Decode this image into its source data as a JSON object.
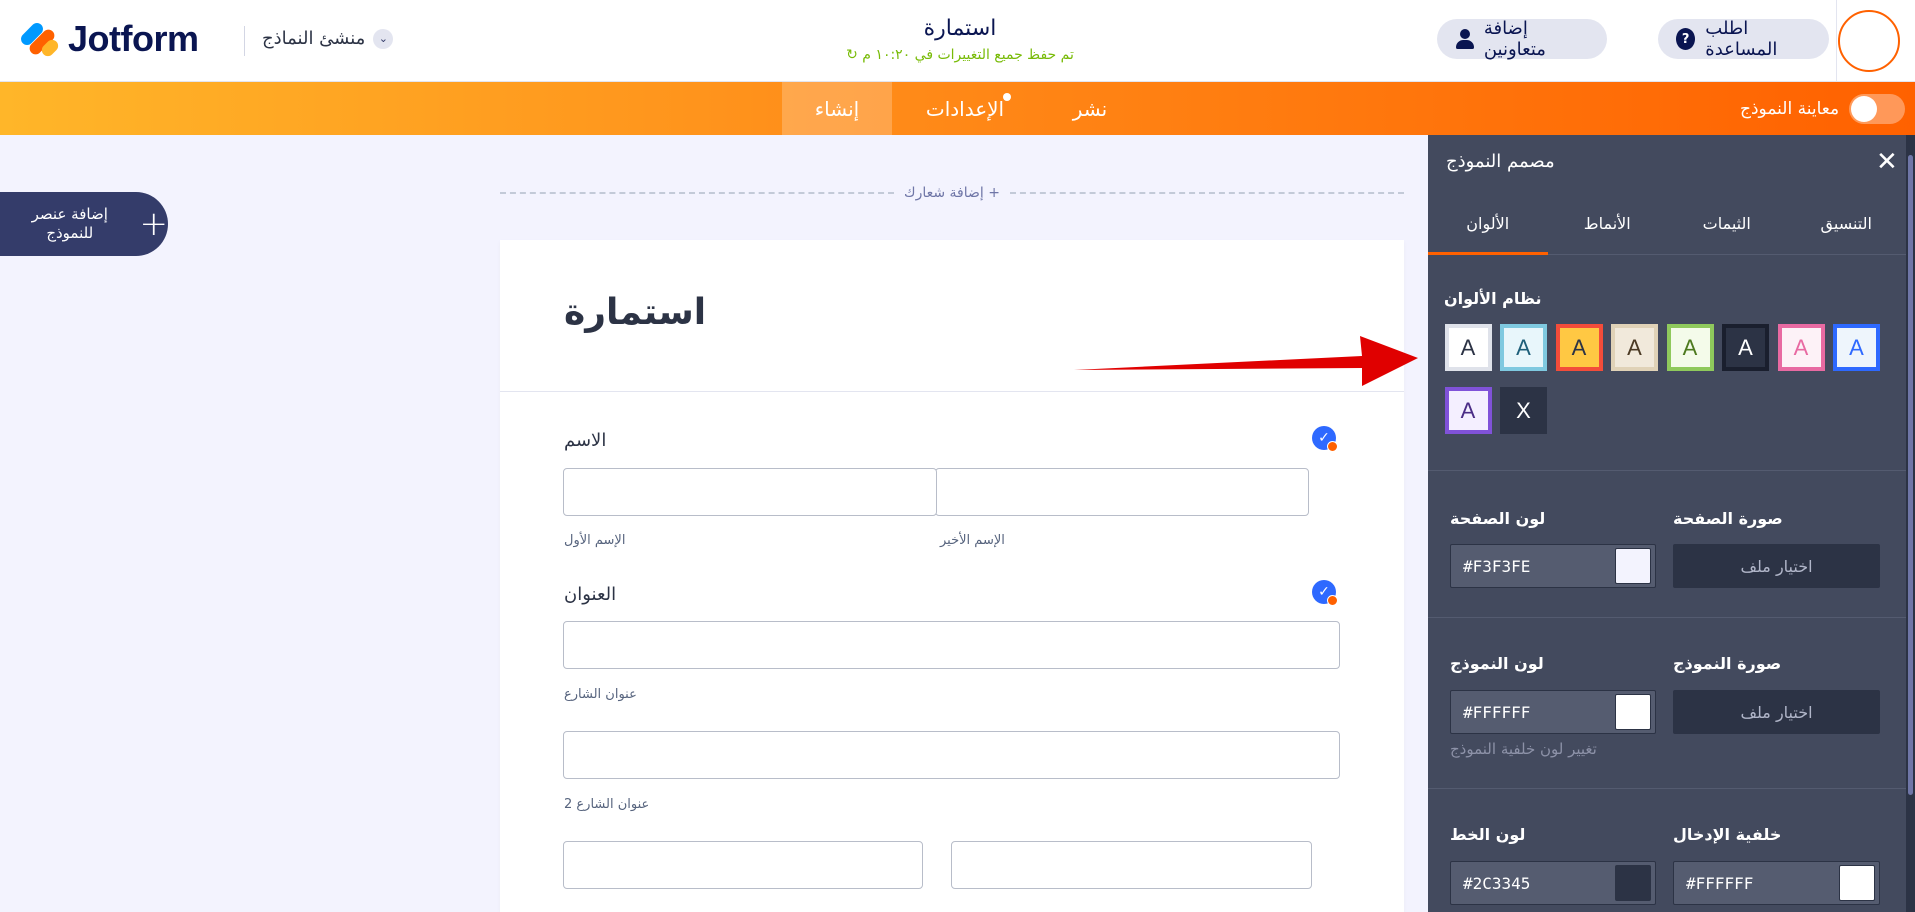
{
  "header": {
    "brand": "Jotform",
    "builder_menu": "منشئ النماذج",
    "form_title": "استمارة",
    "save_status": "تم حفظ جميع التغييرات في ١٠:٢٠ م",
    "add_collaborators": "إضافة متعاونين",
    "ask_help": "اطلب المساعدة"
  },
  "navbar": {
    "build": "إنشاء",
    "settings": "الإعدادات",
    "publish": "نشر",
    "preview_label": "معاينة النموذج",
    "preview_on": false
  },
  "canvas": {
    "add_element": "إضافة عنصر للنموذج",
    "add_logo": "إضافة شعارك +",
    "form_heading": "استمارة",
    "name_label": "الاسم",
    "first_name_sub": "الإسم الأول",
    "last_name_sub": "الإسم الأخير",
    "address_label": "العنوان",
    "street_sub": "عنوان الشارع",
    "street2_sub": "عنوان الشارع 2"
  },
  "panel": {
    "title": "مصمم النموذج",
    "tabs": [
      "الألوان",
      "الأنماط",
      "الثيمات",
      "التنسيق"
    ],
    "active_tab": "الألوان",
    "color_scheme_label": "نظام الألوان",
    "swatches": [
      {
        "text": "A",
        "bg": "#eef5fc",
        "border": "#2e69ff",
        "color": "#2e69ff"
      },
      {
        "text": "A",
        "bg": "#fdf2f7",
        "border": "#e86aa2",
        "color": "#e86aa2"
      },
      {
        "text": "A",
        "bg": "#2c3345",
        "border": "#1a1f2e",
        "color": "#ffffff"
      },
      {
        "text": "A",
        "bg": "#f4fbea",
        "border": "#8fc95c",
        "color": "#4d7a1f"
      },
      {
        "text": "A",
        "bg": "#f1e9db",
        "border": "#e0d2b7",
        "color": "#4b3a24"
      },
      {
        "text": "A",
        "bg": "#ffc843",
        "border": "#f34c3a",
        "color": "#2c3345"
      },
      {
        "text": "A",
        "bg": "#e8f6fb",
        "border": "#7fc9e0",
        "color": "#1e5f7a"
      },
      {
        "text": "A",
        "bg": "#ffffff",
        "border": "#dfe2ea",
        "color": "#2c3345"
      },
      {
        "text": "X",
        "bg": "#2c3345",
        "border": "#2c3345",
        "color": "#ffffff"
      },
      {
        "text": "A",
        "bg": "#f4efff",
        "border": "#8052d9",
        "color": "#4a2c86"
      }
    ],
    "page_color_label": "لون الصفحة",
    "page_color_value": "#F3F3FE",
    "page_color_chip": "#f3f3fe",
    "page_image_label": "صورة الصفحة",
    "choose_file": "اختيار ملف",
    "form_color_label": "لون النموذج",
    "form_color_value": "#FFFFFF",
    "form_color_chip": "#ffffff",
    "form_image_label": "صورة النموذج",
    "form_color_hint": "تغيير لون خلفية النموذج",
    "font_color_label": "لون الخط",
    "font_color_value": "#2C3345",
    "font_color_chip": "#2c3345",
    "input_bg_label": "خلفية الإدخال",
    "input_bg_value": "#FFFFFF",
    "input_bg_chip": "#ffffff"
  }
}
